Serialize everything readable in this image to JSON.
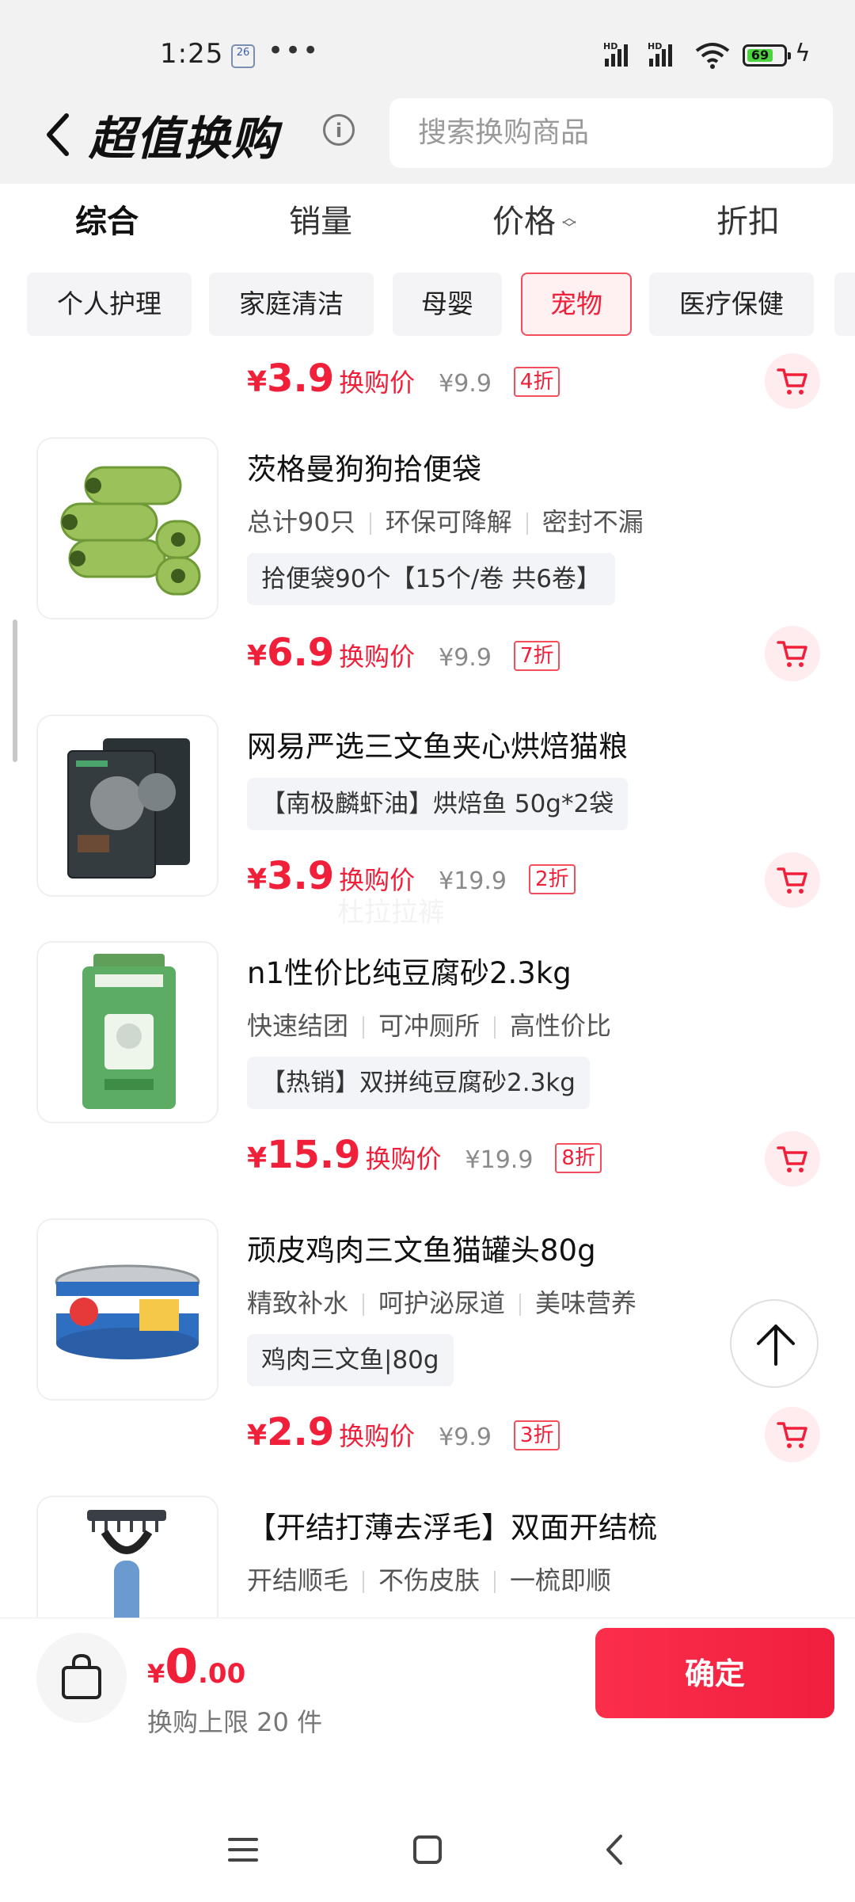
{
  "status_bar": {
    "time": "1:25",
    "calendar_badge": "26",
    "more_dots": "•••",
    "signal_1_label": "HD",
    "signal_2_label": "HD",
    "battery_level": "69",
    "icons": [
      "calendar-icon",
      "signal-icon",
      "signal-icon",
      "wifi-icon",
      "battery-icon",
      "charging-icon"
    ]
  },
  "header": {
    "back_icon": "chevron-left-icon",
    "title": "超值换购",
    "info_glyph": "i",
    "search_placeholder": "搜索换购商品"
  },
  "sort_tabs": [
    {
      "label": "综合",
      "active": true
    },
    {
      "label": "销量",
      "active": false
    },
    {
      "label": "价格",
      "active": false,
      "has_sort_arrows": true
    },
    {
      "label": "折扣",
      "active": false
    }
  ],
  "categories": [
    {
      "label": "个人护理",
      "selected": false
    },
    {
      "label": "家庭清洁",
      "selected": false
    },
    {
      "label": "母婴",
      "selected": false
    },
    {
      "label": "宠物",
      "selected": true
    },
    {
      "label": "医疗保健",
      "selected": false
    }
  ],
  "products": [
    {
      "name": "",
      "tags": [],
      "spec": "",
      "currency": "¥",
      "price": "3.9",
      "price_label": "换购价",
      "original_price": "¥9.9",
      "discount": "4折"
    },
    {
      "name": "茨格曼狗狗拾便袋",
      "tags": [
        "总计90只",
        "环保可降解",
        "密封不漏"
      ],
      "spec": "拾便袋90个【15个/卷 共6卷】",
      "currency": "¥",
      "price": "6.9",
      "price_label": "换购价",
      "original_price": "¥9.9",
      "discount": "7折"
    },
    {
      "name": "网易严选三文鱼夹心烘焙猫粮",
      "tags": [],
      "spec": "【南极麟虾油】烘焙鱼 50g*2袋",
      "currency": "¥",
      "price": "3.9",
      "price_label": "换购价",
      "original_price": "¥19.9",
      "discount": "2折"
    },
    {
      "name": "n1性价比纯豆腐砂2.3kg",
      "tags": [
        "快速结团",
        "可冲厕所",
        "高性价比"
      ],
      "spec": "【热销】双拼纯豆腐砂2.3kg",
      "currency": "¥",
      "price": "15.9",
      "price_label": "换购价",
      "original_price": "¥19.9",
      "discount": "8折"
    },
    {
      "name": "顽皮鸡肉三文鱼猫罐头80g",
      "tags": [
        "精致补水",
        "呵护泌尿道",
        "美味营养"
      ],
      "spec": "鸡肉三文鱼|80g",
      "currency": "¥",
      "price": "2.9",
      "price_label": "换购价",
      "original_price": "¥9.9",
      "discount": "3折"
    },
    {
      "name": "【开结打薄去浮毛】双面开结梳",
      "tags": [
        "开结顺毛",
        "不伤皮肤",
        "一梳即顺"
      ],
      "spec": "",
      "currency": "¥",
      "price": "",
      "price_label": "",
      "original_price": "",
      "discount": ""
    }
  ],
  "watermark": "杜拉拉裤",
  "footer": {
    "currency": "¥",
    "total_int": "0",
    "total_dec": ".00",
    "limit_text": "换购上限 20 件",
    "confirm_label": "确定"
  },
  "system_nav": [
    "menu-icon",
    "home-icon",
    "back-icon"
  ],
  "colors": {
    "accent_red": "#f0203a",
    "header_bg": "#f2f2f3",
    "chip_bg": "#f4f4f6",
    "cart_bg": "#ffecef"
  }
}
